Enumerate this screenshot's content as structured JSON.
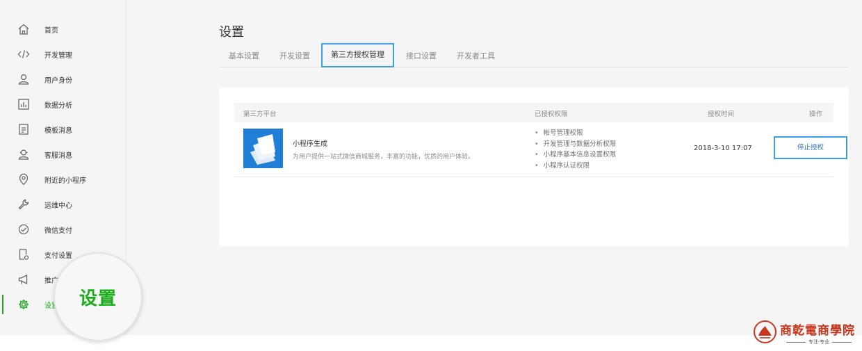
{
  "sidebar": {
    "items": [
      {
        "label": "首页",
        "icon": "home-icon"
      },
      {
        "label": "开发管理",
        "icon": "code-icon"
      },
      {
        "label": "用户身份",
        "icon": "user-icon"
      },
      {
        "label": "数据分析",
        "icon": "chart-icon"
      },
      {
        "label": "模板消息",
        "icon": "document-icon"
      },
      {
        "label": "客服消息",
        "icon": "service-icon"
      },
      {
        "label": "附近的小程序",
        "icon": "location-icon"
      },
      {
        "label": "运维中心",
        "icon": "wrench-icon"
      },
      {
        "label": "微信支付",
        "icon": "pay-icon"
      },
      {
        "label": "支付设置",
        "icon": "pay-settings-icon"
      },
      {
        "label": "推广",
        "icon": "megaphone-icon"
      },
      {
        "label": "设置",
        "icon": "gear-icon"
      }
    ],
    "active_index": 11,
    "magnifier_text": "设置"
  },
  "main": {
    "title": "设置",
    "tabs": [
      {
        "label": "基本设置"
      },
      {
        "label": "开发设置"
      },
      {
        "label": "第三方授权管理"
      },
      {
        "label": "接口设置"
      },
      {
        "label": "开发者工具"
      }
    ],
    "active_tab_index": 2
  },
  "table": {
    "headers": {
      "platform": "第三方平台",
      "permissions": "已授权权限",
      "time": "授权时间",
      "action": "操作"
    },
    "rows": [
      {
        "name": "小程序生成",
        "description": "为用户提供一站式微信商城服务，丰富的功能，优质的用户体验。",
        "permissions": [
          "帐号管理权限",
          "开发管理与数据分析权限",
          "小程序基本信息设置权限",
          "小程序认证权限"
        ],
        "time": "2018-3-10 17:07",
        "action": "停止授权"
      }
    ]
  },
  "brand": {
    "name": "商乾電商學院",
    "slogan": "专注·专业"
  },
  "colors": {
    "accent_green": "#1aad19",
    "highlight_blue": "#3b9fe8",
    "link_blue": "#2f74c2",
    "brand_red": "#c8361d",
    "app_logo_blue": "#1f7fd6"
  }
}
